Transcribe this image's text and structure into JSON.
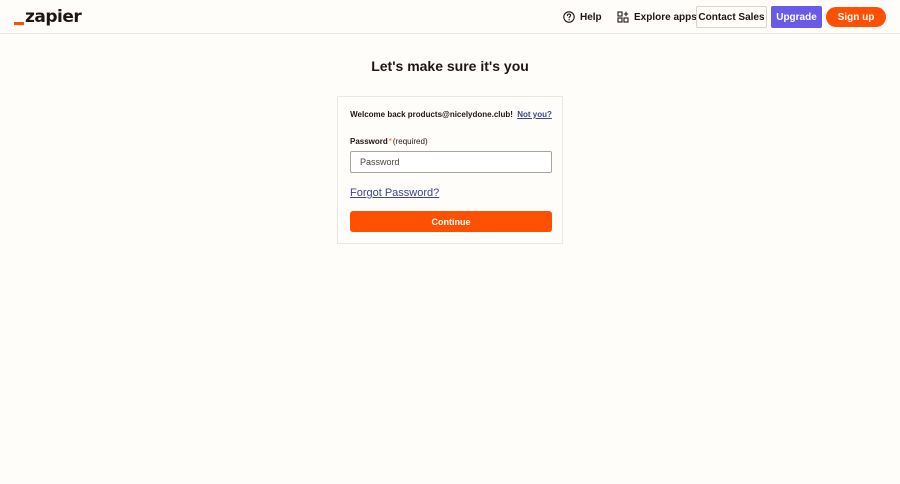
{
  "header": {
    "logo_text": "zapier",
    "help_label": "Help",
    "explore_label": "Explore apps",
    "contact_label": "Contact Sales",
    "upgrade_label": "Upgrade",
    "signup_label": "Sign up"
  },
  "main": {
    "title": "Let's make sure it's you",
    "welcome_text": "Welcome back products@nicelydone.club!",
    "not_you_link": "Not you?",
    "password_label": "Password",
    "required_star": "*",
    "required_text": "(required)",
    "password_placeholder": "Password",
    "forgot_link": "Forgot Password?",
    "continue_label": "Continue"
  },
  "colors": {
    "brand_orange": "#ff4f00",
    "upgrade_purple": "#695be8",
    "link_blue": "#3d4592",
    "background": "#fffdf9"
  }
}
